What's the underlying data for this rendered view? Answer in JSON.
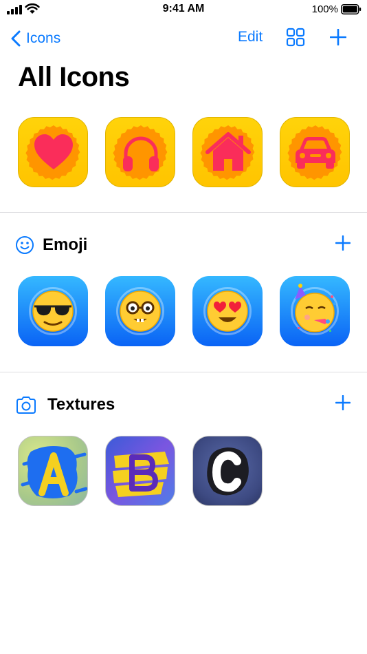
{
  "status_bar": {
    "time": "9:41 AM",
    "battery": "100%"
  },
  "nav": {
    "back_label": "Icons",
    "edit_label": "Edit"
  },
  "page": {
    "title": "All Icons"
  },
  "all_icons": [
    {
      "glyph": "heart-icon",
      "color": "#fa2d5a"
    },
    {
      "glyph": "headphones-icon",
      "color": "#fa2d5a"
    },
    {
      "glyph": "house-icon",
      "color": "#fa2d5a"
    },
    {
      "glyph": "car-icon",
      "color": "#fa2d5a"
    }
  ],
  "sections": {
    "emoji": {
      "label": "Emoji",
      "icons": [
        {
          "glyph": "😎",
          "name": "sunglasses-emoji"
        },
        {
          "glyph": "🤓",
          "name": "nerd-emoji"
        },
        {
          "glyph": "😍",
          "name": "heart-eyes-emoji"
        },
        {
          "glyph": "🥳",
          "name": "party-emoji"
        }
      ]
    },
    "textures": {
      "label": "Textures",
      "icons": [
        {
          "letter": "A",
          "name": "texture-a"
        },
        {
          "letter": "B",
          "name": "texture-b"
        },
        {
          "letter": "C",
          "name": "texture-c"
        }
      ]
    }
  },
  "colors": {
    "accent": "#0a7aff",
    "tile_yellow": "#ffc400",
    "badge_orange": "#ff9500",
    "glyph_pink": "#fa2d5a"
  }
}
